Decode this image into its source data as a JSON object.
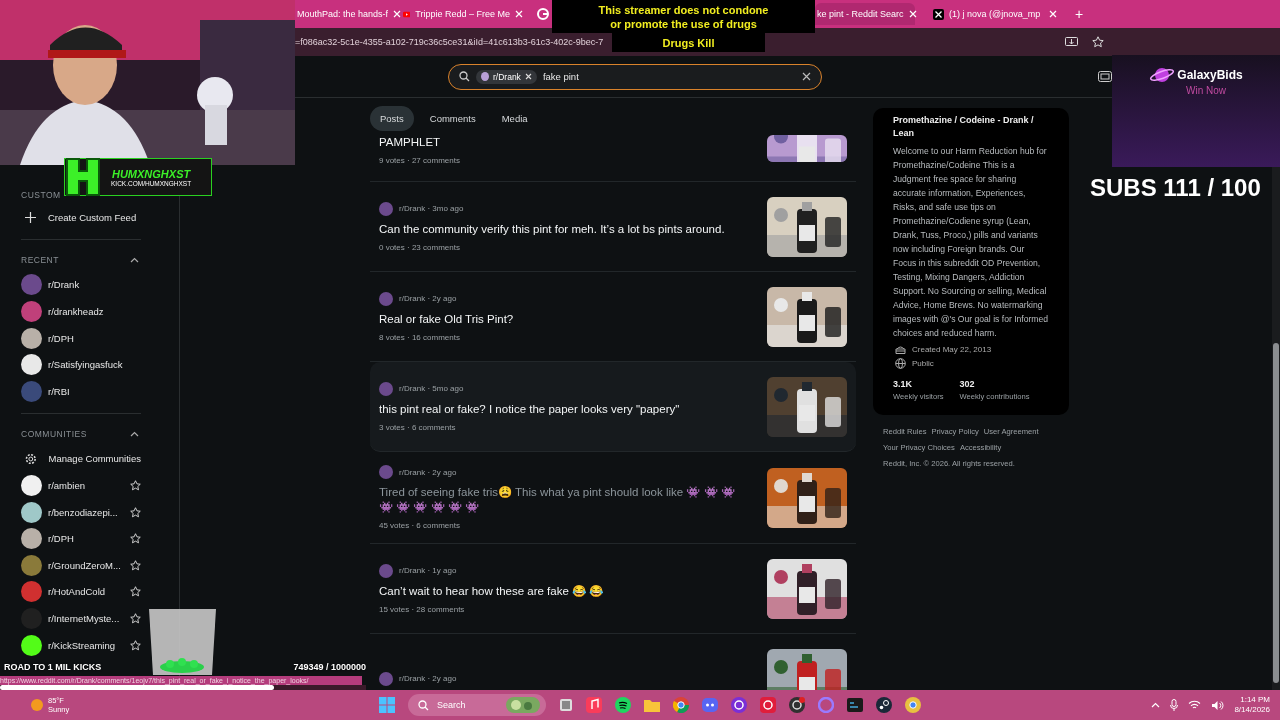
{
  "browser": {
    "tabs": [
      {
        "label": "MouthPad: the hands-f",
        "selected": false
      },
      {
        "label": "Trippie Redd – Free Me",
        "selected": false
      },
      {
        "selected": false
      },
      {
        "label": "ke pint - Reddit Searc",
        "selected": true
      },
      {
        "label": "(1) j nova (@jnova_mp",
        "selected": false
      }
    ],
    "new_tab": "+",
    "url": "=f086ac32-5c1e-4355-a102-719c36c5ce31&iId=41c613b3-61c3-402c-9bec-7"
  },
  "search": {
    "chip": "r/Drank",
    "value": "fake pint"
  },
  "sidebar": {
    "custom_heading": "CUSTOM",
    "create_feed": "Create Custom Feed",
    "recent_heading": "RECENT",
    "recent_expanded": true,
    "recent": [
      {
        "name": "r/Drank",
        "color": "#6b4a8c"
      },
      {
        "name": "r/drankheadz",
        "color": "#c0407a"
      },
      {
        "name": "r/DPH",
        "color": "#b8b0a8"
      },
      {
        "name": "r/Satisfyingasfuck",
        "color": "#e8e8e8"
      },
      {
        "name": "r/RBI",
        "color": "#3a4a7a"
      }
    ],
    "communities_heading": "COMMUNITIES",
    "communities_expanded": true,
    "manage": "Manage Communities",
    "communities": [
      {
        "name": "r/ambien",
        "color": "#f0f0f0",
        "favorite": false
      },
      {
        "name": "r/benzodiazepi...",
        "color": "#9fc8c8",
        "favorite": false
      },
      {
        "name": "r/DPH",
        "color": "#b8b0a8",
        "favorite": false
      },
      {
        "name": "r/GroundZeroM...",
        "color": "#8a7a3a",
        "favorite": false
      },
      {
        "name": "r/HotAndCold",
        "color": "#d03030",
        "favorite": false
      },
      {
        "name": "r/InternetMyste...",
        "color": "#202020",
        "favorite": false
      },
      {
        "name": "r/KickStreaming",
        "color": "#53fc18",
        "favorite": false
      }
    ]
  },
  "feed_tabs": [
    {
      "label": "Posts",
      "selected": true
    },
    {
      "label": "Comments",
      "selected": false
    },
    {
      "label": "Media",
      "selected": false
    }
  ],
  "posts": [
    {
      "title": "PAMPHLET",
      "stats": "9 votes · 27 comments",
      "visited": false,
      "highlighted": false,
      "thumbnail": true
    },
    {
      "meta": "r/Drank · 3mo ago",
      "title": "Can the community verify this pint for meh. It’s a lot bs pints around.",
      "stats": "0 votes · 23 comments",
      "visited": false,
      "highlighted": false,
      "thumbnail": true
    },
    {
      "meta": "r/Drank · 2y ago",
      "title": "Real or fake Old Tris Pint?",
      "stats": "8 votes · 16 comments",
      "visited": false,
      "highlighted": false,
      "thumbnail": true
    },
    {
      "meta": "r/Drank · 5mo ago",
      "title": "this pint real or fake? I notice the paper looks very \"papery\"",
      "stats": "3 votes · 6 comments",
      "visited": false,
      "highlighted": true,
      "thumbnail": true
    },
    {
      "meta": "r/Drank · 2y ago",
      "title": "Tired of seeing fake tris😩 This what ya pint should look like 👾 👾 👾 👾 👾 👾 👾 👾 👾",
      "stats": "45 votes · 6 comments",
      "visited": true,
      "highlighted": false,
      "thumbnail": true
    },
    {
      "meta": "r/Drank · 1y ago",
      "title": "Can’t wait to hear how these are fake 😂 😂",
      "stats": "15 votes · 28 comments",
      "visited": false,
      "highlighted": false,
      "thumbnail": true
    },
    {
      "meta": "r/Drank · 2y ago",
      "highlighted": false,
      "thumbnail": true
    }
  ],
  "about": {
    "title": "Promethazine / Codeine - Drank / Lean",
    "description": "Welcome to our Harm Reduction hub for Promethazine/Codeine This is a Judgment free space for sharing accurate information, Experiences, Risks, and safe use tips on Promethazine/Codiene syrup (Lean, Drank, Tuss, Proco,) pills and variants now including Foreign brands. Our Focus in this subreddit OD Prevention, Testing, Mixing Dangers, Addiction Support. No Sourcing or selling, Medical Advice, Home Brews. No watermarking images with @'s Our goal is for Informed choices and reduced harm.",
    "created": "Created May 22, 2013",
    "visibility": "Public",
    "stats": [
      {
        "value": "3.1K",
        "label": "Weekly visitors"
      },
      {
        "value": "302",
        "label": "Weekly contributions"
      }
    ]
  },
  "footer": {
    "links": [
      [
        "Reddit Rules",
        "Privacy Policy",
        "User Agreement"
      ],
      [
        "Your Privacy Choices",
        "Accessibility"
      ]
    ],
    "copyright": "Reddit, Inc. © 2026. All rights reserved."
  },
  "overlay": {
    "disclaimer": [
      "This streamer does not condone",
      "or promote the use of drugs",
      "Drugs Kill"
    ],
    "streamer": "HUMXNGHXST",
    "channel": "KICK.COM/HUMXNGHXST",
    "ad": {
      "brand": "GalaxyBids",
      "cta": "Win Now"
    },
    "subs": "SUBS 111 / 100",
    "goal": {
      "label": "ROAD TO 1 MIL KICKS",
      "count": "749349 / 1000000",
      "level": 0.749
    }
  },
  "status_url": "https://www.reddit.com/r/Drank/comments/1eojv7/this_pint_real_or_fake_i_notice_the_paper_looks/",
  "taskbar": {
    "temperature": "85°F",
    "weather": "Sunny",
    "search": "Search",
    "time": "1:14 PM",
    "date": "8/14/2026"
  }
}
